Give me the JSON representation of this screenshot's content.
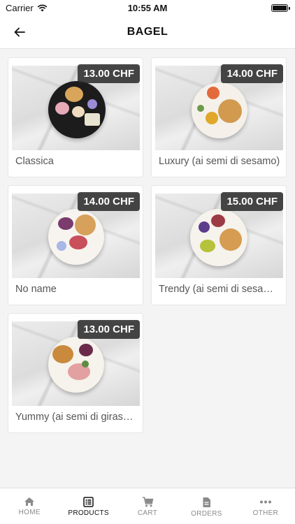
{
  "status": {
    "carrier": "Carrier",
    "time": "10:55 AM"
  },
  "header": {
    "title": "BAGEL"
  },
  "products": [
    {
      "name": "Classica",
      "price": "13.00 CHF"
    },
    {
      "name": "Luxury (ai semi di sesamo)",
      "price": "14.00 CHF"
    },
    {
      "name": "No name",
      "price": "14.00 CHF"
    },
    {
      "name": "Trendy (ai semi di sesamo)",
      "price": "15.00 CHF"
    },
    {
      "name": "Yummy (ai semi di girasole)",
      "price": "13.00 CHF"
    }
  ],
  "tabs": [
    {
      "label": "HOME",
      "icon": "home-icon"
    },
    {
      "label": "PRODUCTS",
      "icon": "list-icon",
      "active": true
    },
    {
      "label": "CART",
      "icon": "cart-icon"
    },
    {
      "label": "ORDERS",
      "icon": "document-icon"
    },
    {
      "label": "OTHER",
      "icon": "more-icon"
    }
  ]
}
